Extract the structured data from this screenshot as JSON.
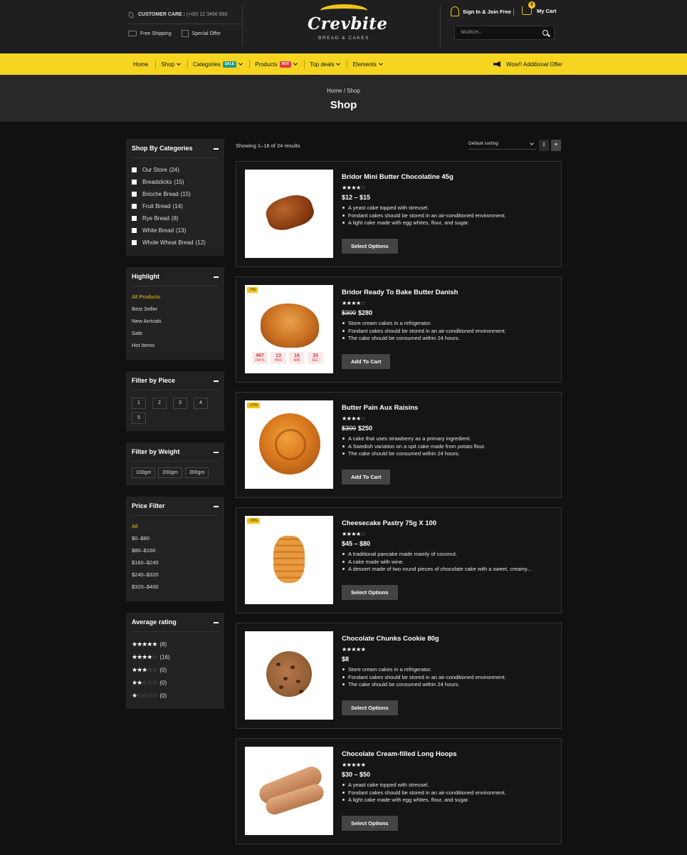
{
  "header": {
    "customer_care_label": "CUSTOMER CARE :",
    "customer_care_phone": "(+00) 12 3456 890",
    "free_shipping": "Free Shipping",
    "special_offer": "Special Offer",
    "logo_text": "Crevbite",
    "logo_sub": "BREAD & CAKES",
    "sign_in": "Sign In & Join Free",
    "cart_label": "My Cart",
    "cart_count": "0",
    "search_placeholder": "SEARCH..."
  },
  "nav": {
    "items": [
      "Home",
      "Shop",
      "Categories",
      "Products",
      "Top deals",
      "Elements"
    ],
    "badge_sale": "SALE",
    "badge_hot": "HOT",
    "offer": "Wow!! Additional Offer"
  },
  "banner": {
    "breadcrumb": "Home / Shop",
    "title": "Shop"
  },
  "sidebar": {
    "categories_title": "Shop By Categories",
    "categories": [
      {
        "label": "Our Store",
        "count": "(24)"
      },
      {
        "label": "Breadsticks",
        "count": "(15)"
      },
      {
        "label": "Brioche Bread",
        "count": "(15)"
      },
      {
        "label": "Fruit Bread",
        "count": "(14)"
      },
      {
        "label": "Rye Bread",
        "count": "(8)"
      },
      {
        "label": "White Bread",
        "count": "(13)"
      },
      {
        "label": "Whole Wheat Bread",
        "count": "(12)"
      }
    ],
    "highlight_title": "Highlight",
    "highlight": [
      "All Products",
      "Best Seller",
      "New Arrivals",
      "Sale",
      "Hot Items"
    ],
    "piece_title": "Filter by Piece",
    "pieces": [
      "1",
      "2",
      "3",
      "4",
      "5"
    ],
    "weight_title": "Filter by Weight",
    "weights": [
      "100gm",
      "200gm",
      "300gm"
    ],
    "price_title": "Price Filter",
    "prices": [
      "All",
      "$0–$80",
      "$80–$160",
      "$160–$240",
      "$240–$320",
      "$320–$400"
    ],
    "rating_title": "Average rating",
    "ratings": [
      {
        "stars": 5,
        "count": "(8)"
      },
      {
        "stars": 4,
        "count": "(16)"
      },
      {
        "stars": 3,
        "count": "(0)"
      },
      {
        "stars": 2,
        "count": "(0)"
      },
      {
        "stars": 1,
        "count": "(0)"
      }
    ]
  },
  "toolbar": {
    "results": "Showing 1–18 of 24 results",
    "sorting": "Default sorting"
  },
  "products": [
    {
      "title": "Bridor Mini Butter Chocolatine 45g",
      "rating": 4,
      "price": "$12 – $15",
      "old_price": "",
      "discount": "",
      "features": [
        "A yeast cake topped with streusel.",
        "Fondant cakes should be stored in an air-conditioned environment.",
        "A light cake made with egg whites, flour, and sugar."
      ],
      "button": "Select Options"
    },
    {
      "title": "Bridor Ready To Bake Butter Danish",
      "rating": 4,
      "price": "$280",
      "old_price": "$300",
      "discount": "-7%",
      "timer": [
        {
          "value": "497",
          "unit": "DAYS"
        },
        {
          "value": "13",
          "unit": "HRS"
        },
        {
          "value": "16",
          "unit": "MIN"
        },
        {
          "value": "33",
          "unit": "SEC"
        }
      ],
      "features": [
        "Store cream cakes in a refrigerator.",
        "Fondant cakes should be stored in an air-conditioned environment.",
        "The cake should be consumed within 24 hours."
      ],
      "button": "Add To Cart"
    },
    {
      "title": "Butter Pain Aux Raisins",
      "rating": 4,
      "price": "$250",
      "old_price": "$300",
      "discount": "-17%",
      "features": [
        "A cake that uses strawberry as a primary ingredient.",
        "A Swedish variation on a spit cake made from potato flour.",
        "The cake should be consumed within 24 hours."
      ],
      "button": "Add To Cart"
    },
    {
      "title": "Cheesecake Pastry 75g X 100",
      "rating": 4,
      "price": "$45 – $80",
      "old_price": "",
      "discount": "-15%",
      "features": [
        "A traditional pancake made mainly of coconut.",
        "A cake made with wine.",
        "A dessert made of two round pieces of chocolate cake with a sweet, creamy..."
      ],
      "button": "Select Options"
    },
    {
      "title": "Chocolate Chunks Cookie 80g",
      "rating": 5,
      "price": "$8",
      "old_price": "",
      "discount": "",
      "features": [
        "Store cream cakes in a refrigerator.",
        "Fondant cakes should be stored in an air-conditioned environment.",
        "The cake should be consumed within 24 hours."
      ],
      "button": "Select Options"
    },
    {
      "title": "Chocolate Cream-filled Long Hoops",
      "rating": 5,
      "price": "$30 – $50",
      "old_price": "",
      "discount": "",
      "features": [
        "A yeast cake topped with streusel.",
        "Fondant cakes should be stored in an air-conditioned environment.",
        "A light cake made with egg whites, flour, and sugar."
      ],
      "button": "Select Options"
    }
  ]
}
